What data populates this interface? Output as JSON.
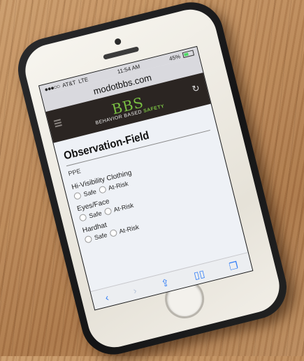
{
  "status": {
    "carrier": "AT&T",
    "network": "LTE",
    "time": "11:54 AM",
    "battery": "45%"
  },
  "browser": {
    "url": "modotbbs.com"
  },
  "site": {
    "logo": "BBS",
    "tagline_prefix": "BEHAVIOR BASED",
    "tagline_emphasis": "SAFETY"
  },
  "page": {
    "title": "Observation-Field",
    "category": "PPE",
    "fields": [
      {
        "label": "Hi-Visibility Clothing",
        "safe_label": "Safe",
        "risk_label": "At-Risk"
      },
      {
        "label": "Eyes/Face",
        "safe_label": "Safe",
        "risk_label": "At-Risk"
      },
      {
        "label": "Hardhat",
        "safe_label": "Safe",
        "risk_label": "At-Risk"
      }
    ]
  },
  "colors": {
    "brand_green": "#7ac043",
    "banner_dark": "#2b2522",
    "ios_blue": "#2f7cf6"
  },
  "icons": {
    "back": "chevron-left-icon",
    "forward": "chevron-right-icon",
    "share": "share-icon",
    "bookmarks": "book-icon",
    "tabs": "tabs-icon",
    "refresh": "refresh-icon",
    "menu": "menu-icon"
  }
}
